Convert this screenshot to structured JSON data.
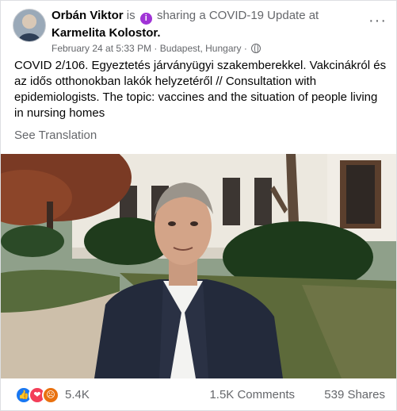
{
  "post": {
    "author": "Orbán Viktor",
    "is_text": "is",
    "activity": "sharing a COVID-19 Update at",
    "location": "Karmelita Kolostor",
    "location_suffix": ".",
    "timestamp": "February 24 at 5:33 PM",
    "separator": "·",
    "place": "Budapest, Hungary",
    "info_icon": "i",
    "more_label": "···",
    "text": "COVID 2/106. Egyeztetés járványügyi szakemberekkel. Vakcinákról és az idős otthonokban lakók helyzetéről // Consultation with epidemiologists. The topic: vaccines and the situation of people living in nursing homes",
    "see_translation": "See Translation"
  },
  "footer": {
    "reaction_icons": [
      "like-icon",
      "love-icon",
      "angry-icon"
    ],
    "reaction_count": "5.4K",
    "comments": "1.5K Comments",
    "shares": "539 Shares"
  },
  "colors": {
    "like": "#1877f2",
    "love": "#f33e58",
    "angry": "#e9710f",
    "info": "#a033d6"
  }
}
